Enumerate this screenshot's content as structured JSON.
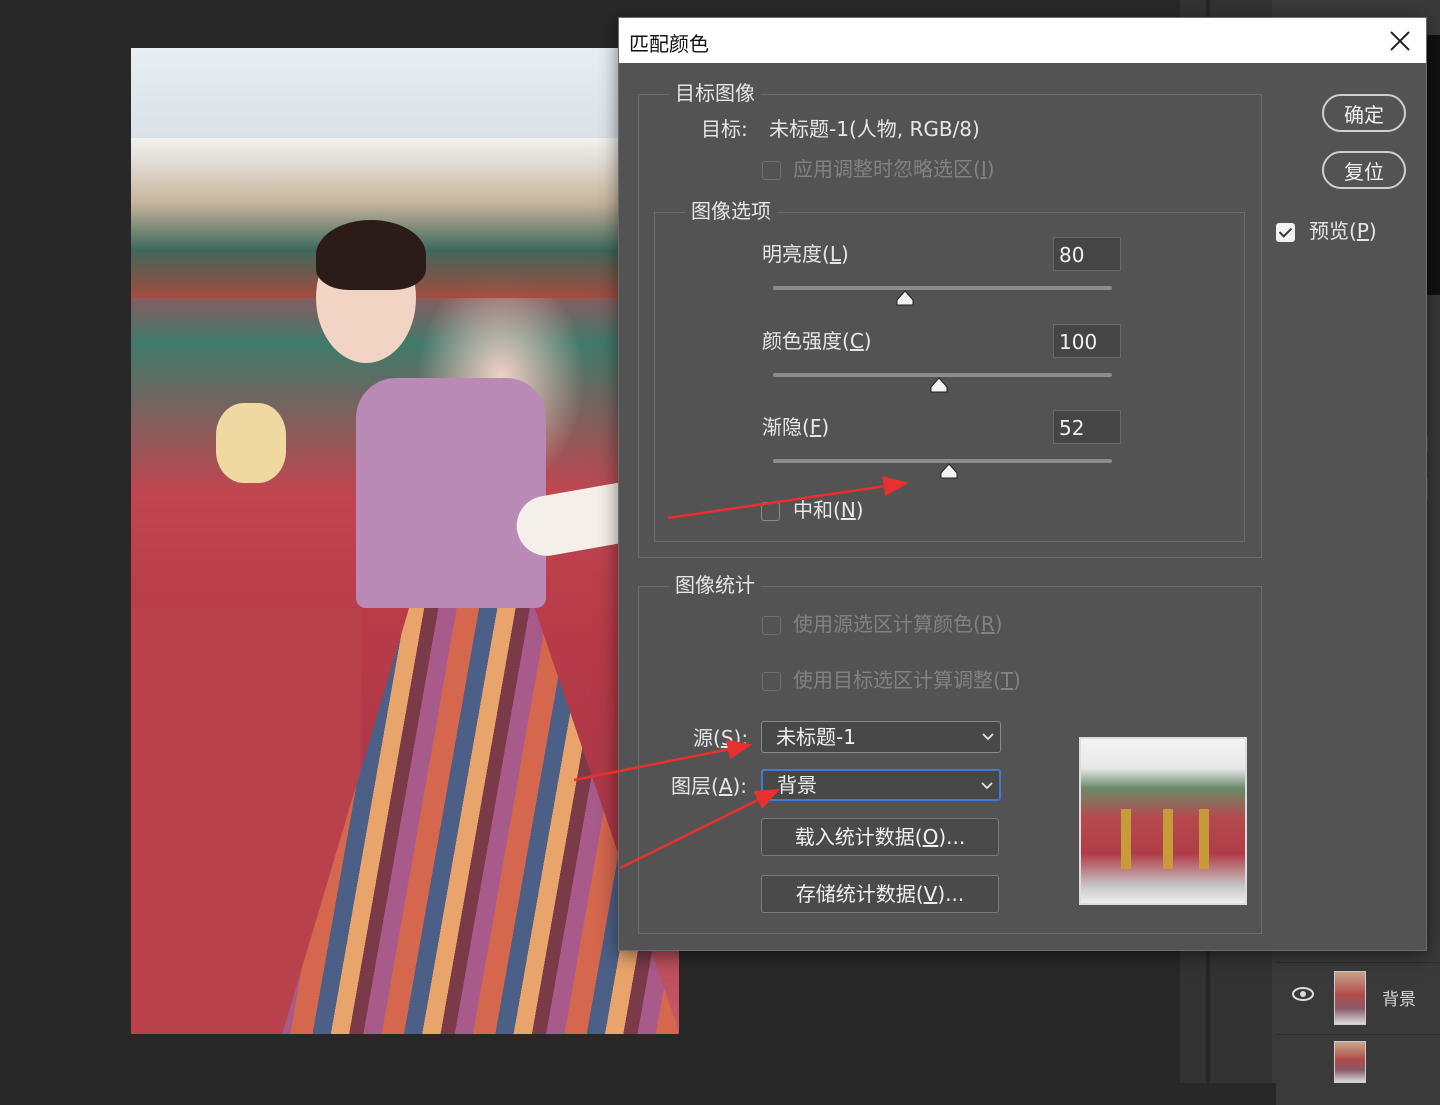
{
  "dialog": {
    "title": "匹配颜色",
    "target_image": {
      "legend": "目标图像",
      "target_label": "目标:",
      "target_value": "未标题-1(人物, RGB/8)",
      "ignore_selection_label": "应用调整时忽略选区",
      "ignore_selection_key": "I"
    },
    "image_options": {
      "legend": "图像选项",
      "brightness": {
        "label": "明亮度",
        "key": "L",
        "value": "80",
        "fraction": 0.39
      },
      "color_intensity": {
        "label": "颜色强度",
        "key": "C",
        "value": "100",
        "fraction": 0.49
      },
      "fade": {
        "label": "渐隐",
        "key": "F",
        "value": "52",
        "fraction": 0.52
      },
      "neutralize": {
        "label": "中和",
        "key": "N"
      }
    },
    "image_statistics": {
      "legend": "图像统计",
      "use_source_selection": {
        "label": "使用源选区计算颜色",
        "key": "R"
      },
      "use_target_selection": {
        "label": "使用目标选区计算调整",
        "key": "T"
      },
      "source_label": "源",
      "source_key": "S",
      "source_value": "未标题-1",
      "layer_label": "图层",
      "layer_key": "A",
      "layer_value": "背景",
      "load_stats": {
        "label": "载入统计数据",
        "key": "O",
        "suffix": ")..."
      },
      "save_stats": {
        "label": "存储统计数据",
        "key": "V",
        "suffix": ")..."
      }
    },
    "buttons": {
      "ok": "确定",
      "reset": "复位"
    },
    "preview": {
      "label": "预览",
      "key": "P",
      "checked": true
    }
  },
  "layers_panel": {
    "layer_name": "背景"
  },
  "colors": {
    "dialog_bg": "#535353",
    "accent_focus": "#3d7bd8",
    "annotation_arrow": "#e8302e"
  }
}
